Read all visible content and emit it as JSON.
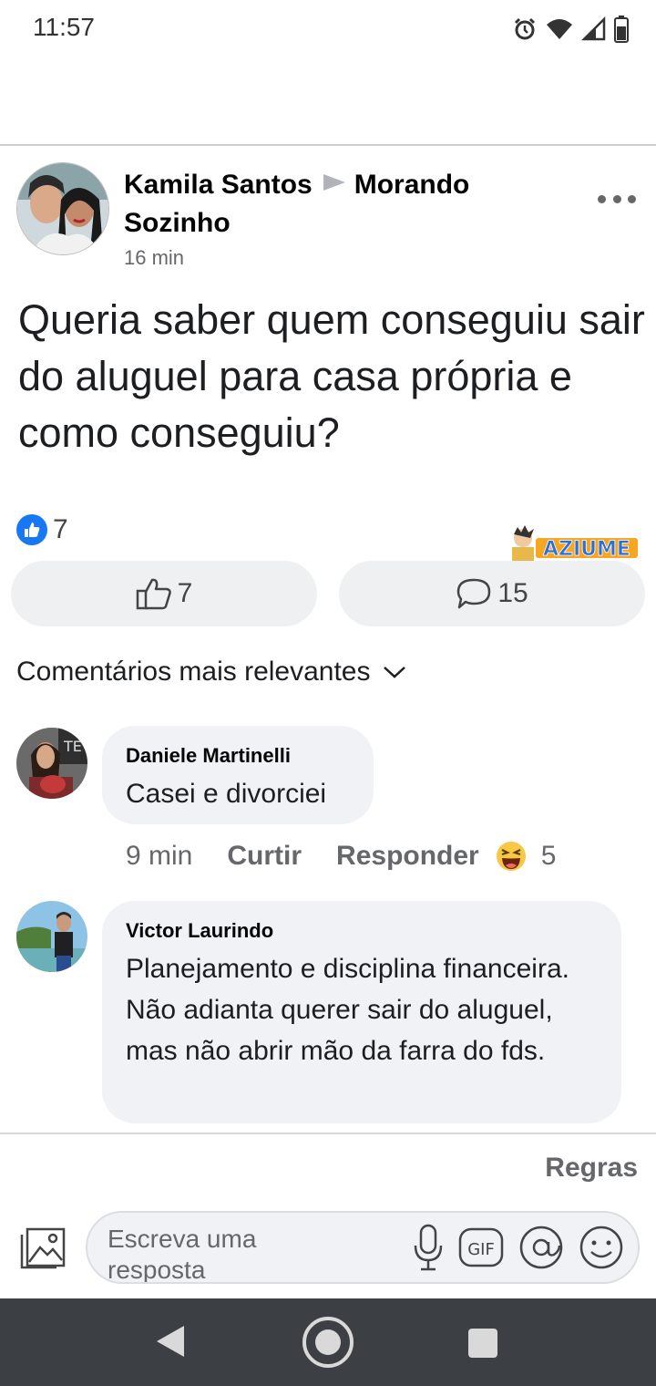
{
  "status_bar": {
    "time": "11:57",
    "icons": [
      "alarm-icon",
      "wifi-icon",
      "signal-icon",
      "battery-icon"
    ]
  },
  "post": {
    "author": "Kamila Santos",
    "group": "Morando Sozinho",
    "time": "16 min",
    "text": "Queria saber quem conseguiu sair do aluguel para casa própria e como conseguiu?",
    "reaction_count": "7",
    "like_count": "7",
    "comment_count": "15"
  },
  "watermark": "AZIUME",
  "comments_sort_label": "Comentários mais relevantes",
  "comments": [
    {
      "author": "Daniele Martinelli",
      "text": "Casei e divorciei",
      "time": "9 min",
      "like_label": "Curtir",
      "reply_label": "Responder",
      "reaction_count": "5"
    },
    {
      "author": "Victor Laurindo",
      "text": "Planejamento e disciplina financeira. Não adianta querer sair do aluguel, mas não abrir mão da farra do fds."
    }
  ],
  "rules_label": "Regras",
  "reply_box": {
    "placeholder": "Escreva uma resposta",
    "gif_label": "GIF"
  },
  "colors": {
    "accent": "#1877f2",
    "bubble": "#f0f2f5",
    "secondary_text": "#65676b",
    "nav_bar": "#3c3f44"
  }
}
